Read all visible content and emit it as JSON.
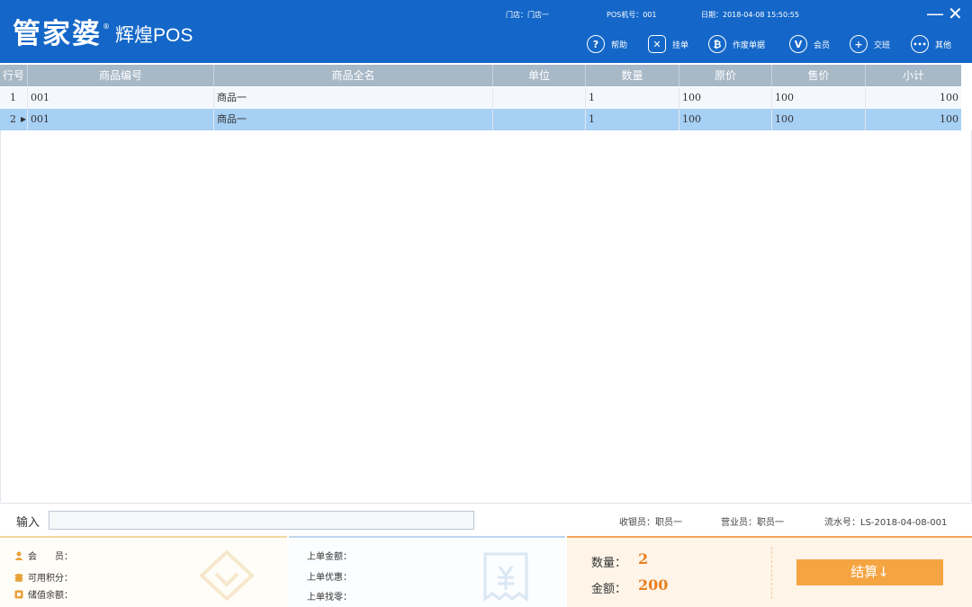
{
  "header": {
    "logo_main": "管家婆",
    "logo_reg": "®",
    "logo_sub": "辉煌POS",
    "store": "门店：门店一",
    "pos_no": "POS机号：001",
    "date": "日期：2018-04-08 15:50:55",
    "minimize": "—",
    "close": "✕"
  },
  "toolbar": [
    {
      "label": "帮助",
      "icon": "help-icon",
      "glyph": "?"
    },
    {
      "label": "挂单",
      "icon": "hold-order-icon",
      "glyph": "✕"
    },
    {
      "label": "作废单据",
      "icon": "void-document-icon",
      "glyph": "₿"
    },
    {
      "label": "会员",
      "icon": "member-icon",
      "glyph": "V"
    },
    {
      "label": "交班",
      "icon": "shift-handover-icon",
      "glyph": "+"
    },
    {
      "label": "其他",
      "icon": "more-icon",
      "glyph": "•••"
    }
  ],
  "grid": {
    "columns": [
      "行号",
      "商品编号",
      "商品全名",
      "单位",
      "数量",
      "原价",
      "售价",
      "小计"
    ],
    "rows": [
      {
        "line": "1",
        "code": "001",
        "name": "商品一",
        "unit": "",
        "qty": "1",
        "orig": "100",
        "price": "100",
        "subtotal": "100"
      },
      {
        "line": "2",
        "code": "001",
        "name": "商品一",
        "unit": "",
        "qty": "1",
        "orig": "100",
        "price": "100",
        "subtotal": "100"
      }
    ],
    "current_row_marker": "▶"
  },
  "input_bar": {
    "label": "输入",
    "value": "",
    "cashier": "收银员：职员一",
    "salesperson": "营业员：职员一",
    "serial": "流水号：LS-2018-04-08-001"
  },
  "member_panel": {
    "member": "会　　员：",
    "points": "可用积分：",
    "balance": "储值余额："
  },
  "last_order_panel": {
    "amount": "上单金额：",
    "discount": "上单优惠：",
    "change": "上单找零："
  },
  "summary": {
    "qty_label": "数量：",
    "qty_value": "2",
    "amount_label": "金额：",
    "amount_value": "200",
    "settle_label": "结算↓"
  },
  "colors": {
    "header_blue": "#1467c8",
    "grid_header": "#a7b8c7",
    "selected_row": "#a7d0f5",
    "accent_orange": "#f5a442",
    "value_orange": "#e87f1f"
  }
}
